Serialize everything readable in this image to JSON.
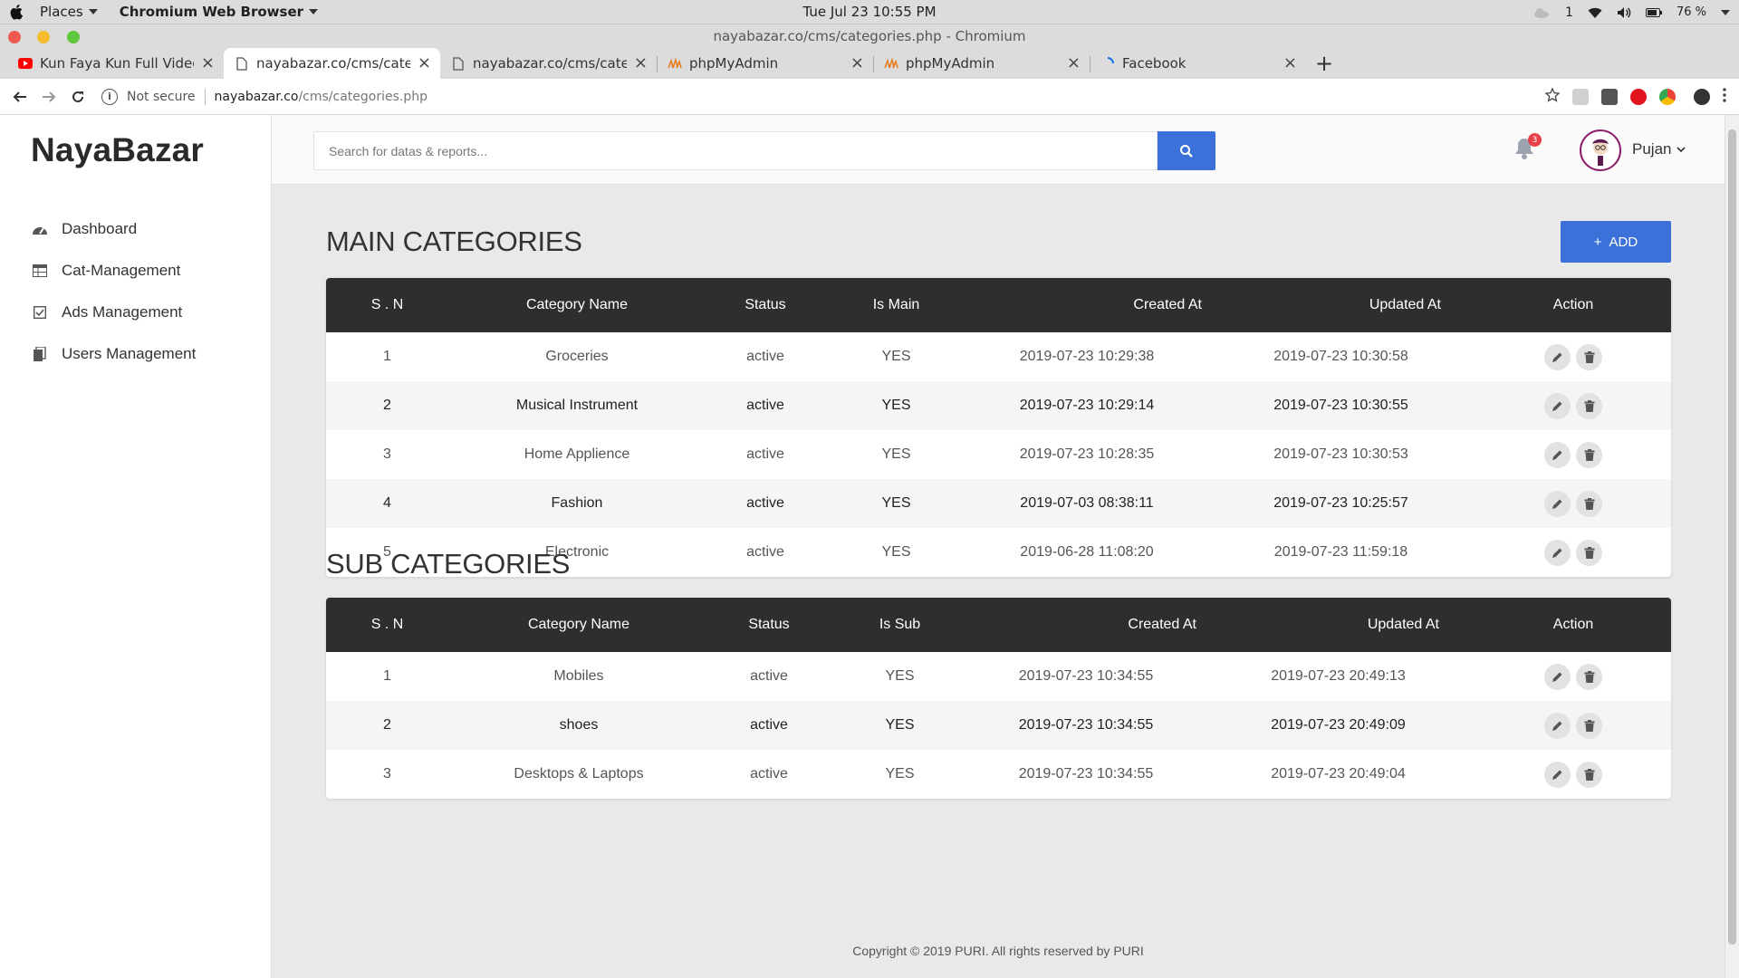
{
  "os": {
    "places_label": "Places",
    "app_label": "Chromium Web Browser",
    "clock": "Tue Jul 23  10:55 PM",
    "workspace": "1",
    "battery": "76 %"
  },
  "window": {
    "title": "nayabazar.co/cms/categories.php - Chromium"
  },
  "tabs": [
    {
      "label": "Kun Faya Kun Full Video S",
      "icon": "youtube-icon"
    },
    {
      "label": "nayabazar.co/cms/catego",
      "icon": "page-icon"
    },
    {
      "label": "nayabazar.co/cms/catego",
      "icon": "page-icon"
    },
    {
      "label": "phpMyAdmin",
      "icon": "phpmyadmin-icon"
    },
    {
      "label": "phpMyAdmin",
      "icon": "phpmyadmin-icon"
    },
    {
      "label": "Facebook",
      "icon": "loading-icon"
    }
  ],
  "omnibox": {
    "security": "Not secure",
    "host": "nayabazar.co",
    "path": "/cms/categories.php"
  },
  "brand": "NayaBazar",
  "sidebar": {
    "items": [
      {
        "label": "Dashboard",
        "icon": "dashboard-icon"
      },
      {
        "label": "Cat-Management",
        "icon": "table-icon"
      },
      {
        "label": "Ads Management",
        "icon": "checkbox-icon"
      },
      {
        "label": "Users Management",
        "icon": "documents-icon"
      }
    ]
  },
  "header": {
    "search_placeholder": "Search for datas & reports...",
    "notification_count": "3",
    "user_name": "Pujan"
  },
  "main_categories": {
    "title": "MAIN CATEGORIES",
    "add_label": "ADD",
    "columns": [
      "S . N",
      "Category Name",
      "Status",
      "Is Main",
      "Created At",
      "Updated At",
      "Action"
    ],
    "rows": [
      [
        "1",
        "Groceries",
        "active",
        "YES",
        "2019-07-23 10:29:38",
        "2019-07-23 10:30:58"
      ],
      [
        "2",
        "Musical Instrument",
        "active",
        "YES",
        "2019-07-23 10:29:14",
        "2019-07-23 10:30:55"
      ],
      [
        "3",
        "Home Applience",
        "active",
        "YES",
        "2019-07-23 10:28:35",
        "2019-07-23 10:30:53"
      ],
      [
        "4",
        "Fashion",
        "active",
        "YES",
        "2019-07-03 08:38:11",
        "2019-07-23 10:25:57"
      ],
      [
        "5",
        "Electronic",
        "active",
        "YES",
        "2019-06-28 11:08:20",
        "2019-07-23 11:59:18"
      ]
    ]
  },
  "sub_categories": {
    "title": "SUB CATEGORIES",
    "columns": [
      "S . N",
      "Category Name",
      "Status",
      "Is Sub",
      "Created At",
      "Updated At",
      "Action"
    ],
    "rows": [
      [
        "1",
        "Mobiles",
        "active",
        "YES",
        "2019-07-23 10:34:55",
        "2019-07-23 20:49:13"
      ],
      [
        "2",
        "shoes",
        "active",
        "YES",
        "2019-07-23 10:34:55",
        "2019-07-23 20:49:09"
      ],
      [
        "3",
        "Desktops & Laptops",
        "active",
        "YES",
        "2019-07-23 10:34:55",
        "2019-07-23 20:49:04"
      ]
    ]
  },
  "footer": "Copyright © 2019 PURI. All rights reserved by PURI",
  "colors": {
    "accent": "#3b71d8",
    "table_header": "#2e2e2e",
    "badge": "#e8414a"
  }
}
